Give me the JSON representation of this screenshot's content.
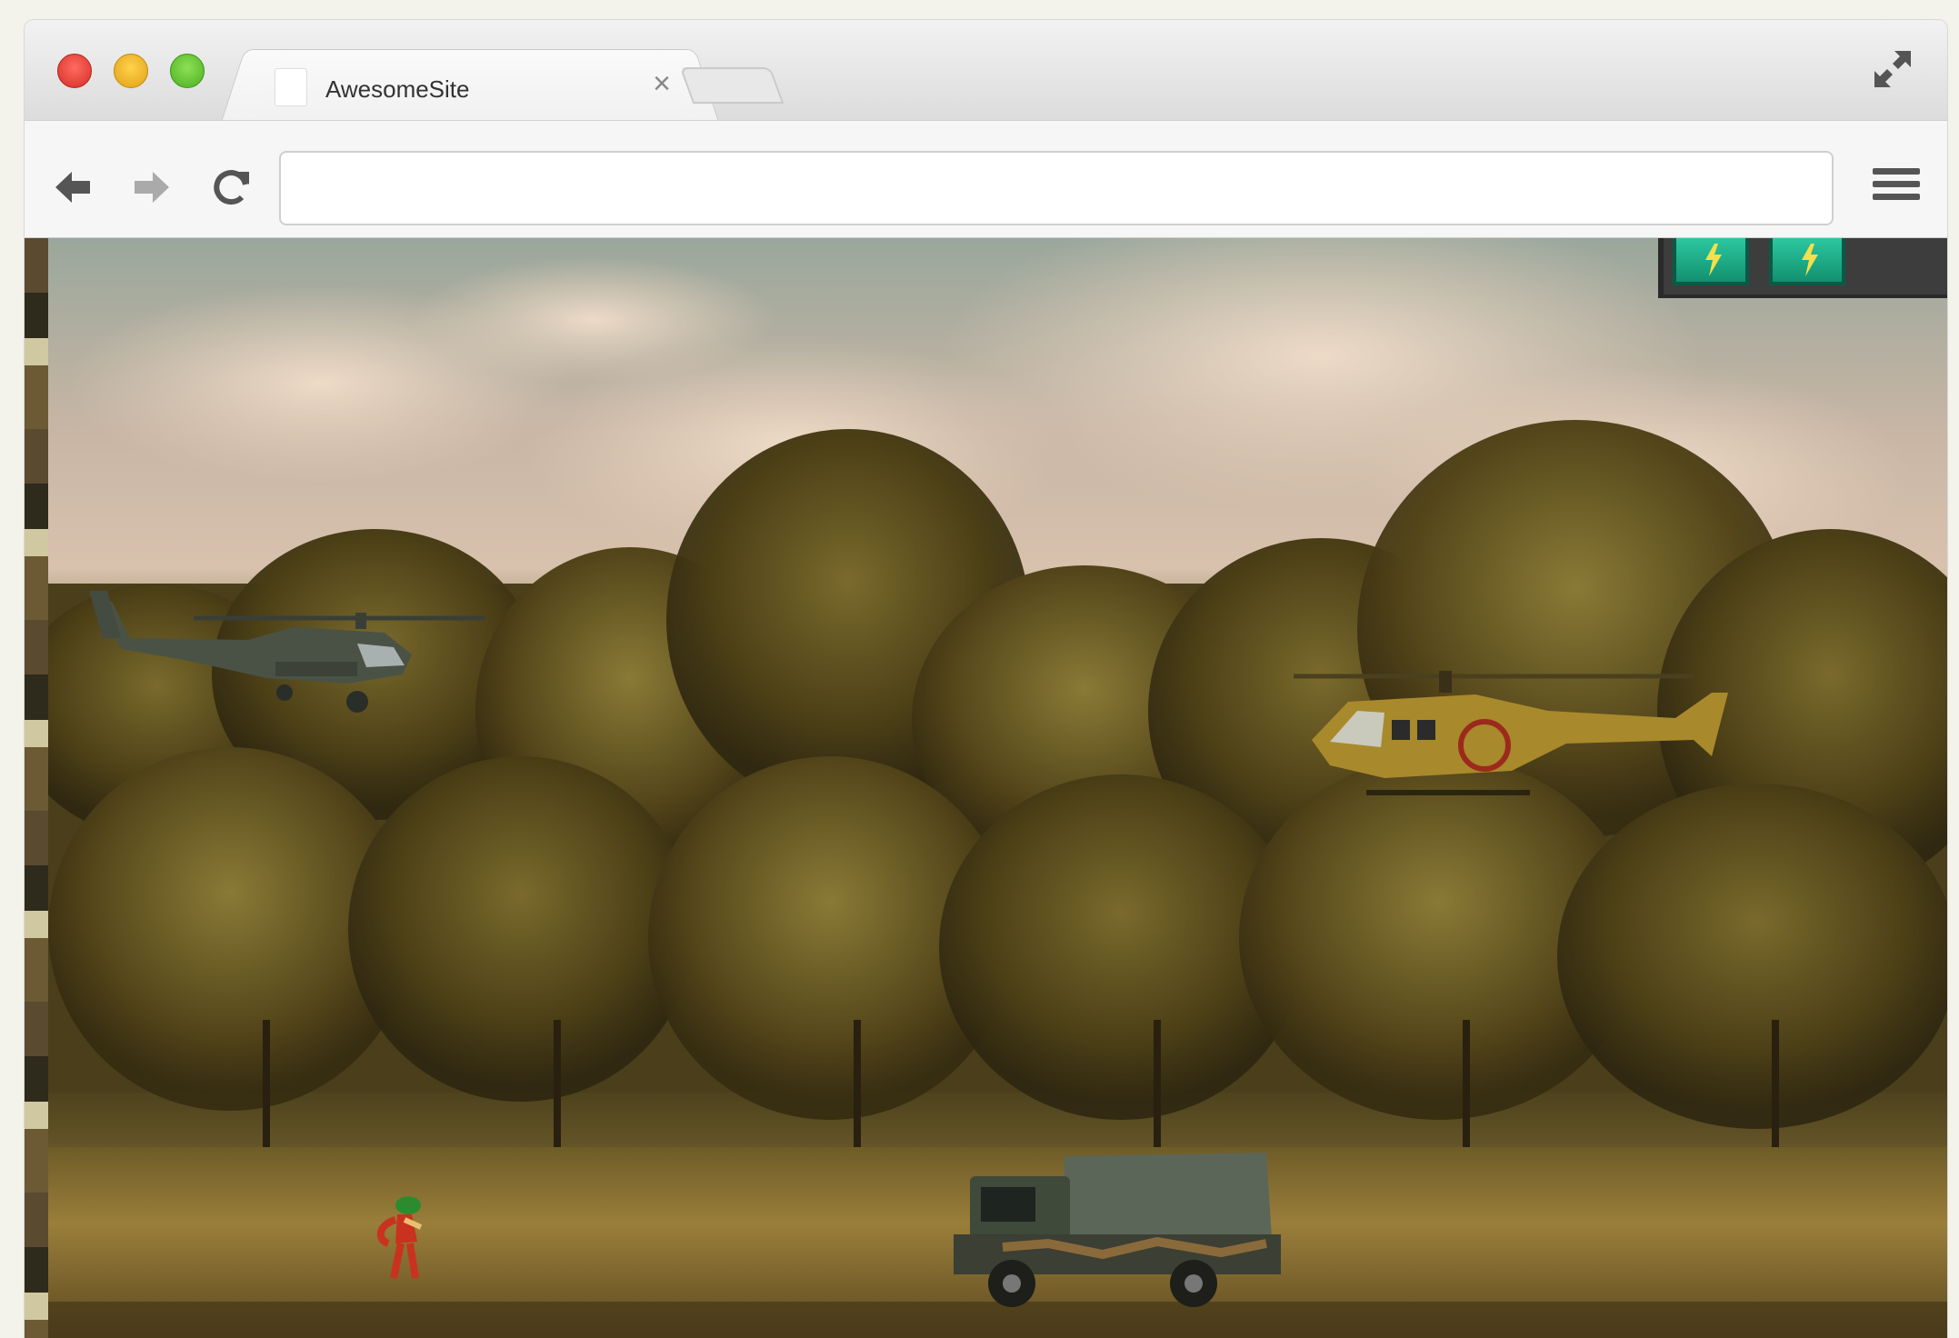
{
  "browser": {
    "tab_title": "AwesomeSite",
    "tab_close": "×",
    "url": ""
  },
  "game": {
    "powerups": [
      {
        "icon": "lightning-icon",
        "color": "#1fb08a"
      },
      {
        "icon": "lightning-icon",
        "color": "#1fb08a"
      }
    ],
    "entities": [
      {
        "name": "attack-helicopter",
        "color": "#4a5245"
      },
      {
        "name": "civil-helicopter",
        "color": "#a8892c"
      },
      {
        "name": "army-truck",
        "color": "#5b6658"
      },
      {
        "name": "soldier",
        "color": "#c8321e"
      }
    ]
  }
}
